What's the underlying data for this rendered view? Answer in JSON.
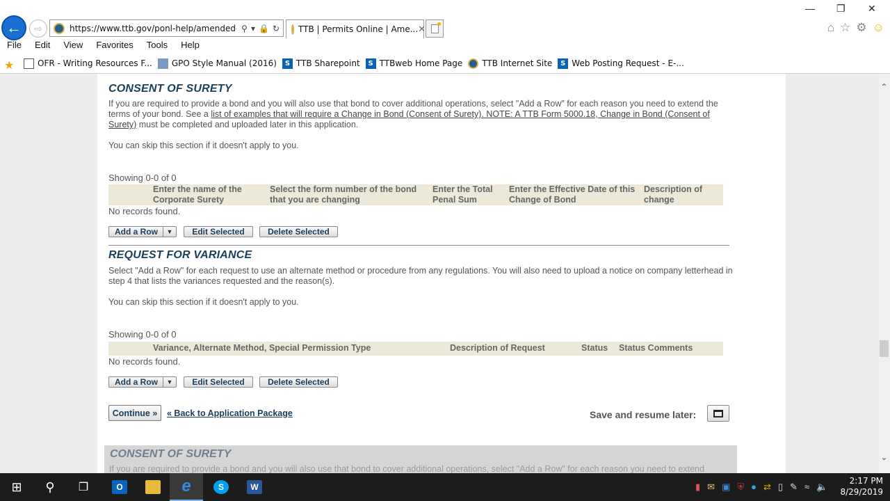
{
  "browser": {
    "url": "https://www.ttb.gov/ponl-help/amended-app",
    "tab_title": "TTB | Permits Online | Ame...",
    "menu": [
      "File",
      "Edit",
      "View",
      "Favorites",
      "Tools",
      "Help"
    ],
    "favorites": [
      {
        "label": "OFR - Writing Resources F...",
        "icon": "document-icon"
      },
      {
        "label": "GPO Style Manual (2016)",
        "icon": "gpo-icon"
      },
      {
        "label": "TTB Sharepoint",
        "icon": "sharepoint-icon"
      },
      {
        "label": "TTBweb Home Page",
        "icon": "sharepoint-icon"
      },
      {
        "label": "TTB Internet Site",
        "icon": "ttb-seal-icon"
      },
      {
        "label": "Web Posting Request - E-...",
        "icon": "sharepoint-icon"
      }
    ]
  },
  "consent": {
    "title": "CONSENT OF SURETY",
    "para1_a": "If you are required to provide a bond and you will also use that bond to cover additional operations, select \"Add a Row\" for each reason you need to extend the terms of your bond. See a ",
    "para1_link": "list of examples that will require a Change in Bond (Consent of Surety). NOTE: A TTB Form 5000.18, Change in Bond (Consent of Surety)",
    "para1_b": " must be completed and uploaded later in this application.",
    "skip": "You can skip this section if it doesn't apply to you.",
    "showing": "Showing 0-0 of 0",
    "columns": [
      "Enter the name of the Corporate Surety",
      "Select the form number of the bond that you are changing",
      "Enter the Total Penal Sum",
      "Enter the Effective Date of this Change of Bond",
      "Description of change"
    ],
    "no_records": "No records found.",
    "add_row": "Add a Row",
    "edit_selected": "Edit Selected",
    "delete_selected": "Delete Selected"
  },
  "variance": {
    "title": "REQUEST FOR VARIANCE",
    "para": "Select \"Add a Row\" for each request to use an alternate method or procedure from any regulations. You will also need to upload a notice on company letterhead in step 4 that lists the variances requested and the reason(s).",
    "skip": "You can skip this section if it doesn't apply to you.",
    "showing": "Showing 0-0 of 0",
    "columns": [
      "Variance, Alternate Method, Special Permission Type",
      "Description of Request",
      "Status",
      "Status Comments"
    ],
    "no_records": "No records found.",
    "add_row": "Add a Row",
    "edit_selected": "Edit Selected",
    "delete_selected": "Delete Selected"
  },
  "footer": {
    "continue": "Continue »",
    "back_link": "« Back to Application Package",
    "save_resume": "Save and resume later:"
  },
  "ghost": {
    "title": "CONSENT OF SURETY",
    "para": "If you are required to provide a bond and you will also use that bond to cover additional operations, select \"Add a Row\" for each reason you need to extend"
  },
  "taskbar": {
    "time": "2:17 PM",
    "date": "8/29/2019",
    "apps": [
      "outlook-icon",
      "file-explorer-icon",
      "internet-explorer-icon",
      "skype-icon",
      "word-icon"
    ]
  }
}
